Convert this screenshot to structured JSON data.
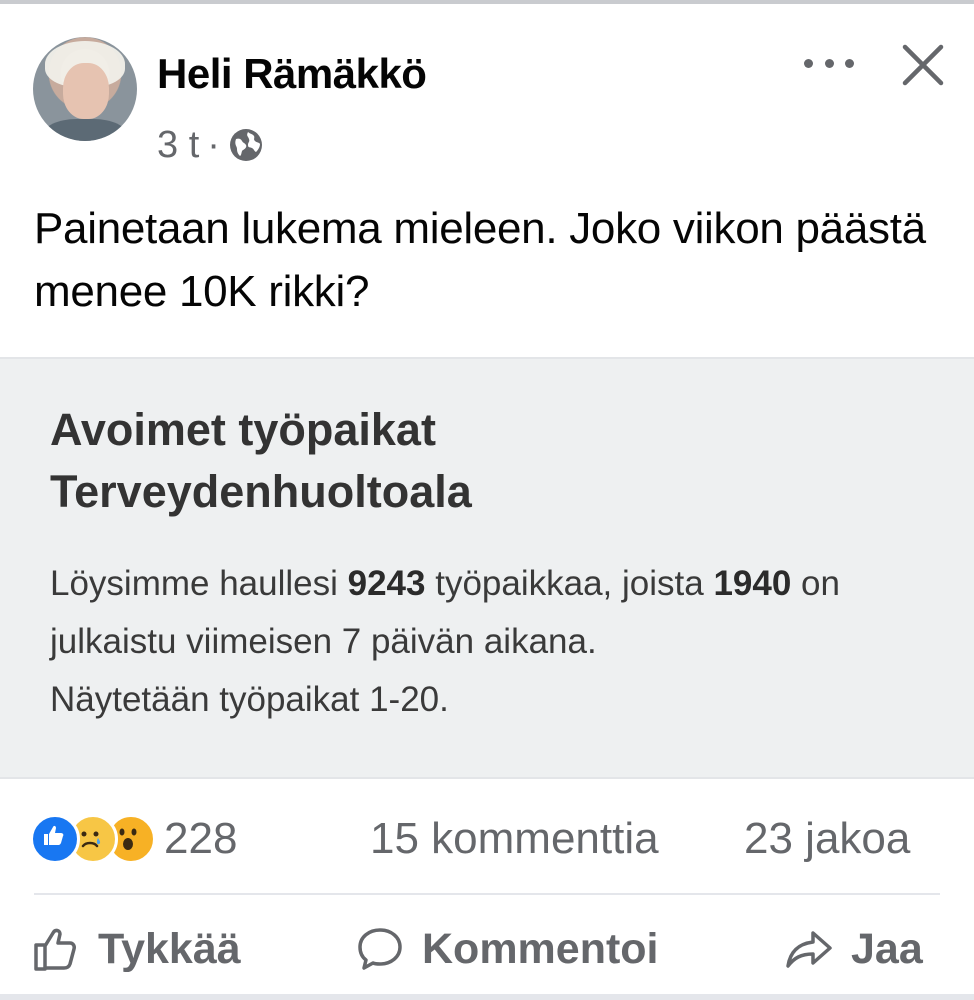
{
  "post": {
    "author": "Heli Rämäkkö",
    "time": "3 t",
    "separator": "·",
    "text": "Painetaan lukema mieleen. Joko viikon päästä menee 10K rikki?"
  },
  "card": {
    "title_line1": "Avoimet työpaikat",
    "title_line2": "Terveydenhuoltoala",
    "body_prefix": "Löysimme haullesi ",
    "total_count": "9243",
    "body_mid": " työpaikkaa, joista ",
    "recent_count": "1940",
    "body_suffix": " on julkaistu viimeisen 7 päivän aikana.",
    "body_line3": "Näytetään työpaikat 1-20."
  },
  "stats": {
    "reaction_count": "228",
    "comments": "15 kommenttia",
    "shares": "23 jakoa"
  },
  "actions": {
    "like": "Tykkää",
    "comment": "Kommentoi",
    "share": "Jaa"
  },
  "icons": {
    "privacy": "globe-icon",
    "more": "more-options-icon",
    "close": "close-icon",
    "reactions": [
      "like-reaction-icon",
      "sad-reaction-icon",
      "wow-reaction-icon"
    ]
  },
  "colors": {
    "like_blue": "#1877f2",
    "secondary_text": "#65676b",
    "card_background": "#eef0f1"
  }
}
